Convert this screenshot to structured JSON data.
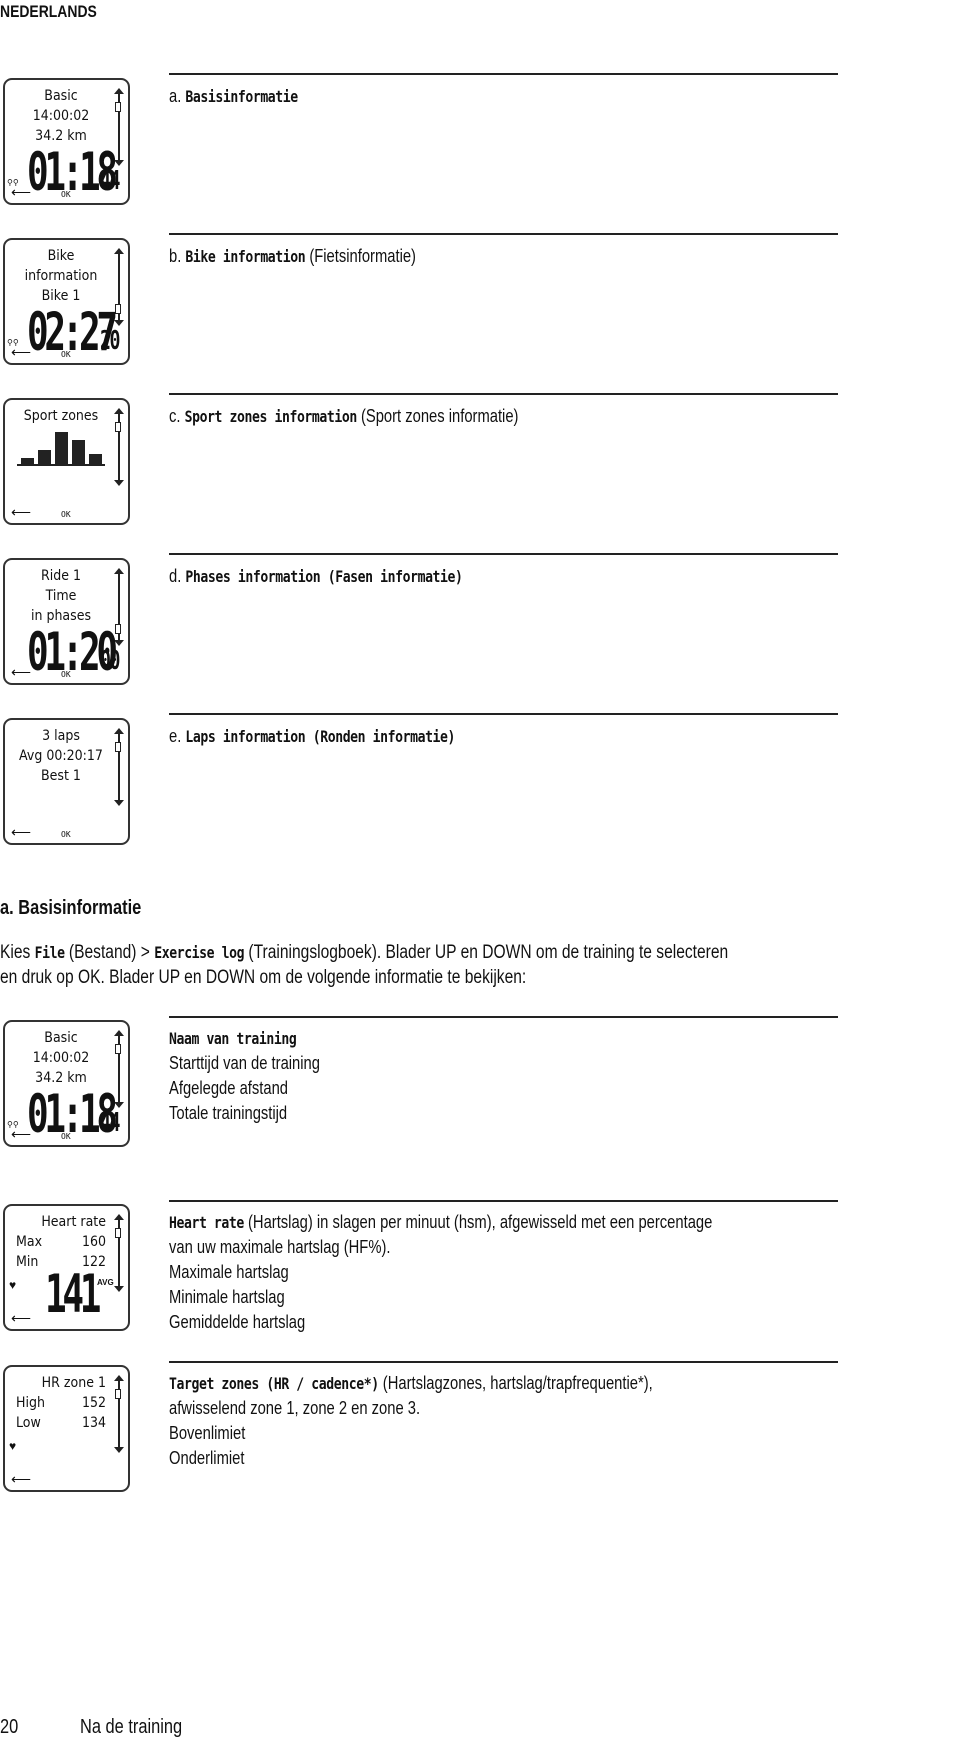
{
  "header": "NEDERLANDS",
  "menu_items": [
    {
      "prefix": "a.",
      "term": "Basisinformatie",
      "rest": ""
    },
    {
      "prefix": "b.",
      "term": "Bike information",
      "rest": " (Fietsinformatie)"
    },
    {
      "prefix": "c.",
      "term": "Sport zones information",
      "rest": " (Sport zones informatie)"
    },
    {
      "prefix": "d.",
      "term": "Phases information (Fasen informatie)",
      "rest": ""
    },
    {
      "prefix": "e.",
      "term": "Laps information (Ronden informatie)",
      "rest": ""
    }
  ],
  "devices": {
    "basic": {
      "lines": [
        "Basic",
        "14:00:02",
        "34.2 km"
      ],
      "big": "01:18",
      "small": "44",
      "ok": "OK"
    },
    "bike": {
      "lines": [
        "Bike",
        "information",
        "Bike 1"
      ],
      "big": "02:27",
      "small": "20",
      "ok": "OK"
    },
    "sport": {
      "lines": [
        "Sport zones"
      ],
      "zone_levels": [
        0.2,
        0.45,
        1.0,
        0.75,
        0.3
      ],
      "ok": "OK"
    },
    "phases": {
      "lines": [
        "Ride 1",
        "Time",
        "in phases"
      ],
      "big": "01:20",
      "small": "00",
      "ok": "OK"
    },
    "laps": {
      "lines": [
        "3 laps",
        "Avg 00:20:17",
        "Best 1"
      ],
      "ok": "OK"
    },
    "hr": {
      "title": "Heart rate",
      "rows": [
        [
          "Max",
          "160"
        ],
        [
          "Min",
          "122"
        ]
      ],
      "big": "141",
      "suffix": "AVG"
    },
    "zone": {
      "title": "HR zone 1",
      "rows": [
        [
          "High",
          "152"
        ],
        [
          "Low",
          "134"
        ]
      ]
    }
  },
  "section": {
    "title": "a. Basisinformatie",
    "para": {
      "t1": "Kies ",
      "k1": "File",
      "t2": " (Bestand) > ",
      "k2": "Exercise log",
      "t3": " (Trainingslogboek). Blader UP en DOWN om de training te selecteren",
      "line2": "en druk op OK. Blader UP en DOWN om de volgende informatie te bekijken:"
    }
  },
  "details": [
    {
      "term": "Naam van training",
      "rest": "",
      "lines": [
        "Starttijd van de training",
        "Afgelegde afstand",
        "Totale trainingstijd"
      ]
    },
    {
      "term": "Heart rate",
      "rest": " (Hartslag) in slagen per minuut (hsm), afgewisseld met een percentage",
      "lines": [
        "van uw maximale hartslag (HF%).",
        "Maximale hartslag",
        "Minimale hartslag",
        "Gemiddelde hartslag"
      ]
    },
    {
      "term": "Target zones (HR / cadence*)",
      "rest": " (Hartslagzones, hartslag/trapfrequentie*),",
      "lines": [
        "afwisselend zone 1, zone 2 en zone 3.",
        "Bovenlimiet",
        "Onderlimiet"
      ]
    }
  ],
  "footer": {
    "page": "20",
    "chapter": "Na de training"
  }
}
